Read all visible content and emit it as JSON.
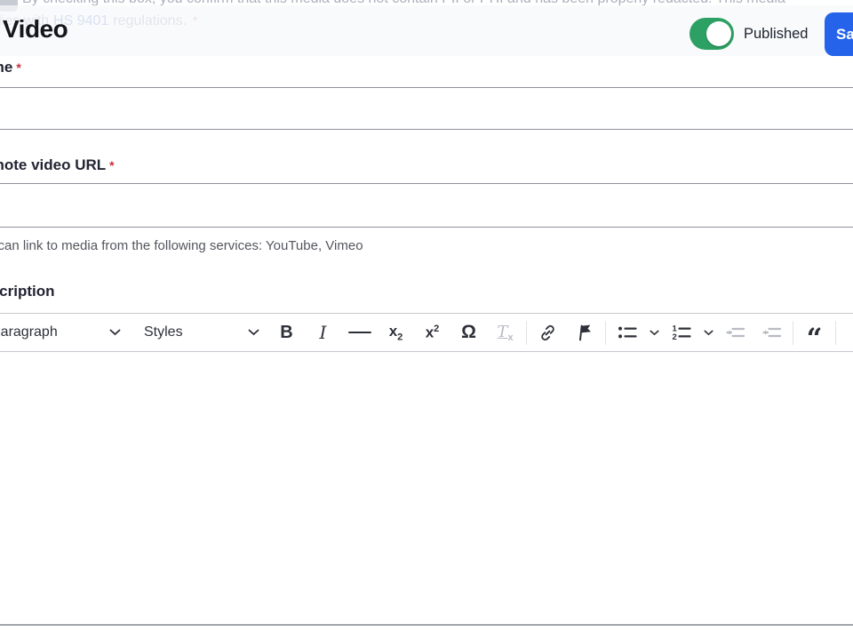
{
  "header": {
    "title": "Video",
    "published_label": "Published",
    "toggle_state": "on",
    "save_label": "Save"
  },
  "scrolled": {
    "line1": "By checking this box, you confirm that this media does not contain PII or PHI and has been properly redacted. This media",
    "line2_prefix": "complies with",
    "line2_link": "HS 9401",
    "line2_suffix": "regulations.",
    "required_marker": "*"
  },
  "form": {
    "required_marker": "*",
    "name": {
      "label": "Name",
      "value": "",
      "required": true
    },
    "remote_video_url": {
      "label": "Remote video URL",
      "value": "",
      "required": true,
      "description": "You can link to media from the following services: YouTube, Vimeo"
    },
    "description": {
      "label": "Description"
    }
  },
  "editor": {
    "toolbar": {
      "paragraph_label": "Paragraph",
      "styles_label": "Styles",
      "bold_glyph": "B",
      "italic_glyph": "I",
      "subscript_base": "x",
      "subscript_mark": "2",
      "superscript_base": "x",
      "superscript_mark": "2",
      "special_characters_glyph": "Ω",
      "remove_format_base": "T",
      "remove_format_mark": "x",
      "block_quote_glyph": "“",
      "disabled_buttons": [
        "remove-format",
        "outdent",
        "indent"
      ]
    },
    "icons": {
      "chevron_down": "v-chevron",
      "horizontal_line": "bar",
      "link": "chain",
      "bookmark": "flag",
      "bulleted_list": "dots-with-lines",
      "numbered_list": "numbers-with-lines",
      "outdent": "arrow-left-lines",
      "indent": "arrow-right-lines"
    },
    "content": ""
  },
  "colors": {
    "primary_button": "#2563eb",
    "published_toggle": "#2da164",
    "required_marker": "#c8303d"
  }
}
